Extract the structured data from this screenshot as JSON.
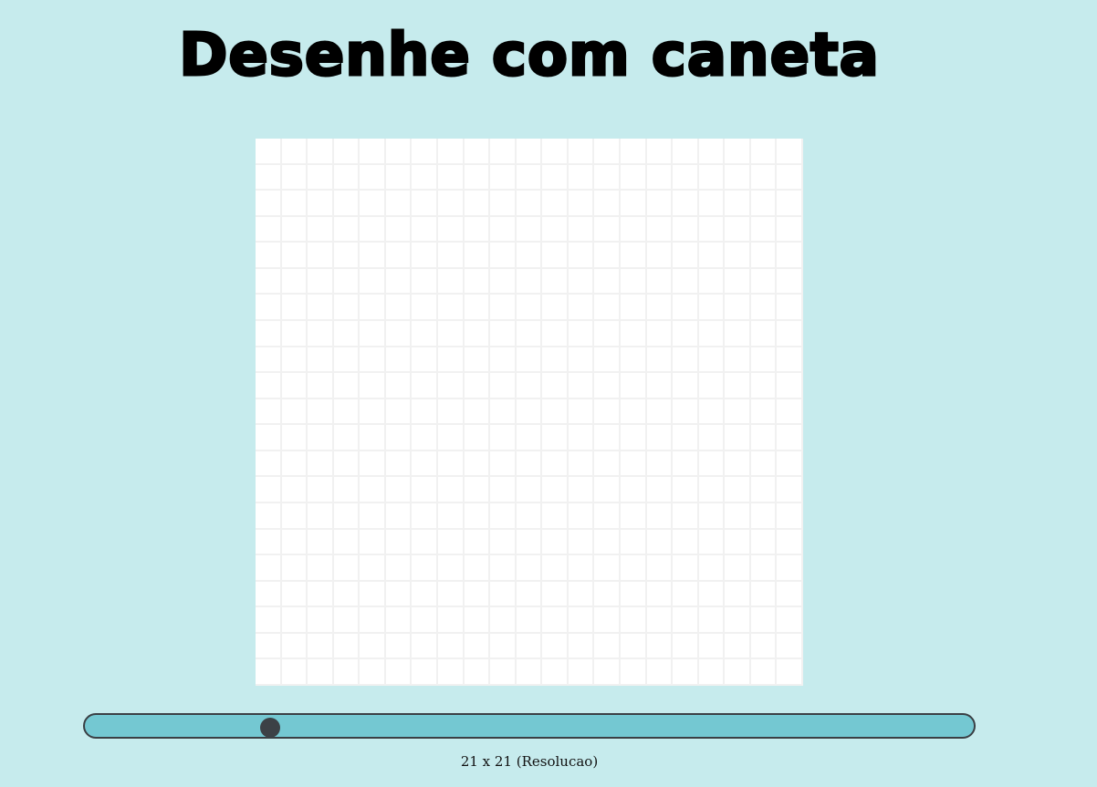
{
  "title": "Desenhe com caneta",
  "canvas": {
    "rows": 21,
    "columns": 21,
    "background_color": "#ffffff",
    "gridline_color": "#f1f1f1"
  },
  "resolution_slider": {
    "value": 21,
    "min": 1,
    "max": 100,
    "track_color": "#74c8d2",
    "thumb_color": "#3c4146"
  },
  "resolution_label": "21 x 21 (Resolucao)",
  "page_background": "#c6ebed"
}
